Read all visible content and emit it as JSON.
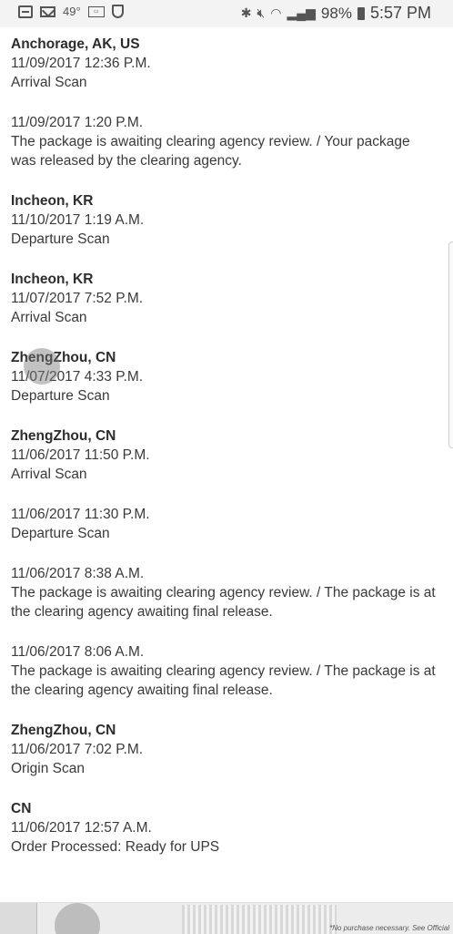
{
  "status_bar": {
    "temperature": "49°",
    "battery_percent": "98%",
    "time": "5:57 PM",
    "icons": [
      "box-icon",
      "mail-icon",
      "card-icon",
      "shield-icon",
      "bluetooth-icon",
      "mute-icon",
      "wifi-icon",
      "signal-icon",
      "battery-icon"
    ]
  },
  "events": [
    {
      "location": "Anchorage, AK, US",
      "datetime": "11/09/2017 12:36 P.M.",
      "activity": "Arrival Scan"
    },
    {
      "location": "",
      "datetime": "11/09/2017 1:20 P.M.",
      "activity": "The package is awaiting clearing agency review. / Your package was released by the clearing agency."
    },
    {
      "location": "Incheon, KR",
      "datetime": "11/10/2017 1:19 A.M.",
      "activity": "Departure Scan"
    },
    {
      "location": "Incheon, KR",
      "datetime": "11/07/2017 7:52 P.M.",
      "activity": "Arrival Scan"
    },
    {
      "location": "ZhengZhou, CN",
      "datetime": "11/07/2017 4:33 P.M.",
      "activity": "Departure Scan"
    },
    {
      "location": "ZhengZhou, CN",
      "datetime": "11/06/2017 11:50 P.M.",
      "activity": "Arrival Scan"
    },
    {
      "location": "",
      "datetime": "11/06/2017 11:30 P.M.",
      "activity": "Departure Scan"
    },
    {
      "location": "",
      "datetime": "11/06/2017 8:38 A.M.",
      "activity": "The package is awaiting clearing agency review. / The package is at the clearing agency awaiting final release."
    },
    {
      "location": "",
      "datetime": "11/06/2017 8:06 A.M.",
      "activity": "The package is awaiting clearing agency review. / The package is at the clearing agency awaiting final release."
    },
    {
      "location": "ZhengZhou, CN",
      "datetime": "11/06/2017 7:02 P.M.",
      "activity": "Origin Scan"
    },
    {
      "location": "CN",
      "datetime": "11/06/2017 12:57 A.M.",
      "activity": "Order Processed: Ready for UPS"
    }
  ],
  "ad": {
    "disclaimer": "*No purchase necessary. See Official"
  }
}
